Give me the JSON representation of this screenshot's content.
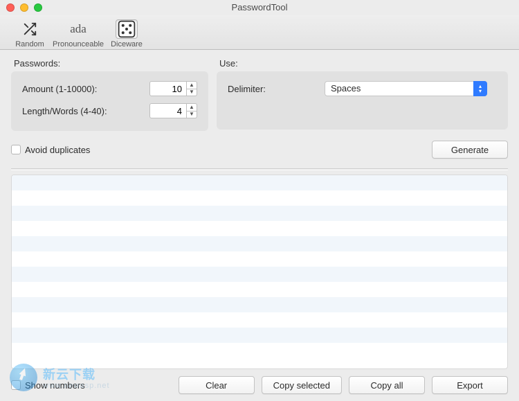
{
  "window": {
    "title": "PasswordTool"
  },
  "toolbar": {
    "random": {
      "label": "Random"
    },
    "pronounceable": {
      "label": "Pronounceable",
      "glyph": "ada"
    },
    "diceware": {
      "label": "Diceware"
    }
  },
  "panels": {
    "passwords": {
      "title": "Passwords:",
      "amount_label": "Amount (1-10000):",
      "amount_value": "10",
      "length_label": "Length/Words (4-40):",
      "length_value": "4"
    },
    "use": {
      "title": "Use:",
      "delimiter_label": "Delimiter:",
      "delimiter_value": "Spaces"
    }
  },
  "checkboxes": {
    "avoid_duplicates": "Avoid duplicates",
    "show_numbers": "Show numbers"
  },
  "buttons": {
    "generate": "Generate",
    "clear": "Clear",
    "copy_selected": "Copy selected",
    "copy_all": "Copy all",
    "export": "Export"
  },
  "watermark": {
    "brand": "新云下载",
    "url": "www.newasp.net"
  }
}
